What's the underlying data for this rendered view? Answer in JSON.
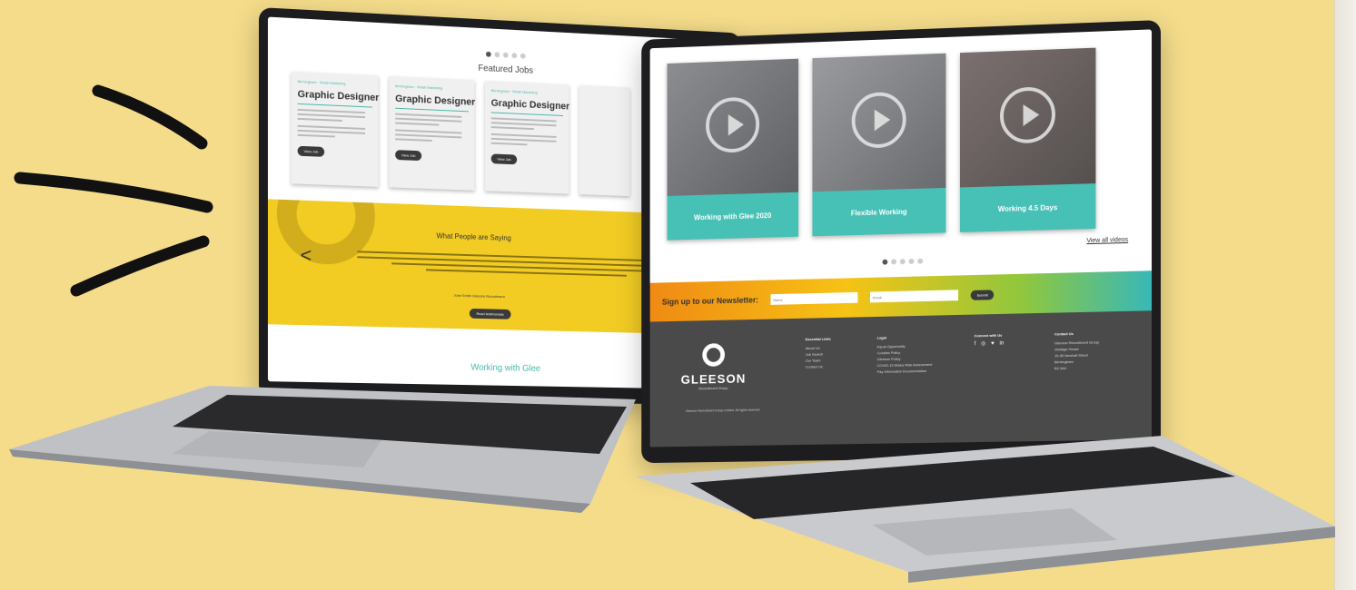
{
  "left_site": {
    "featured_title": "Featured Jobs",
    "jobs": [
      {
        "title": "Graphic Designer",
        "category": "Birmingham · Retail Marketing",
        "button": "View Job"
      },
      {
        "title": "Graphic Designer",
        "category": "Birmingham · Retail Marketing",
        "button": "View Job"
      },
      {
        "title": "Graphic Designer",
        "category": "Birmingham · Retail Marketing",
        "button": "View Job"
      }
    ],
    "testimonial_title": "What People are Saying",
    "testimonial_prev": "<",
    "testimonial_author": "John Smith Gleeson Recruitment",
    "testimonial_button": "Read testimonials",
    "working_with": "Working with Glee"
  },
  "right_site": {
    "videos": [
      {
        "caption": "Working with Glee 2020"
      },
      {
        "caption": "Flexible Working"
      },
      {
        "caption": "Working 4.5 Days"
      }
    ],
    "view_all": "View all videos",
    "newsletter": {
      "label": "Sign up to our Newsletter:",
      "name_placeholder": "Name",
      "email_placeholder": "Email",
      "submit": "Submit"
    },
    "footer": {
      "logo_name": "GLEESON",
      "logo_sub": "Recruitment Group",
      "copyright": "Gleeson Recruitment Group Limited. All rights reserved.",
      "essential_heading": "Essential Links",
      "essential_links": [
        "About Us",
        "Job Search",
        "Our Team",
        "Contact Us"
      ],
      "legal_heading": "Legal",
      "legal_links": [
        "Equal Opportunity",
        "Cookies Policy",
        "Gleeson Policy",
        "COVID-19 Status Risk Assessment",
        "Pay Information Documentation"
      ],
      "connect_heading": "Connect with Us",
      "connect_icons": [
        "f",
        "◎",
        "♥",
        "in"
      ],
      "contact_heading": "Contact Us",
      "contact_lines": [
        "Gleeson Recruitment Group",
        "Vantage House",
        "15-35 Newhall Street",
        "Birmingham",
        "B3 3AX"
      ]
    }
  }
}
